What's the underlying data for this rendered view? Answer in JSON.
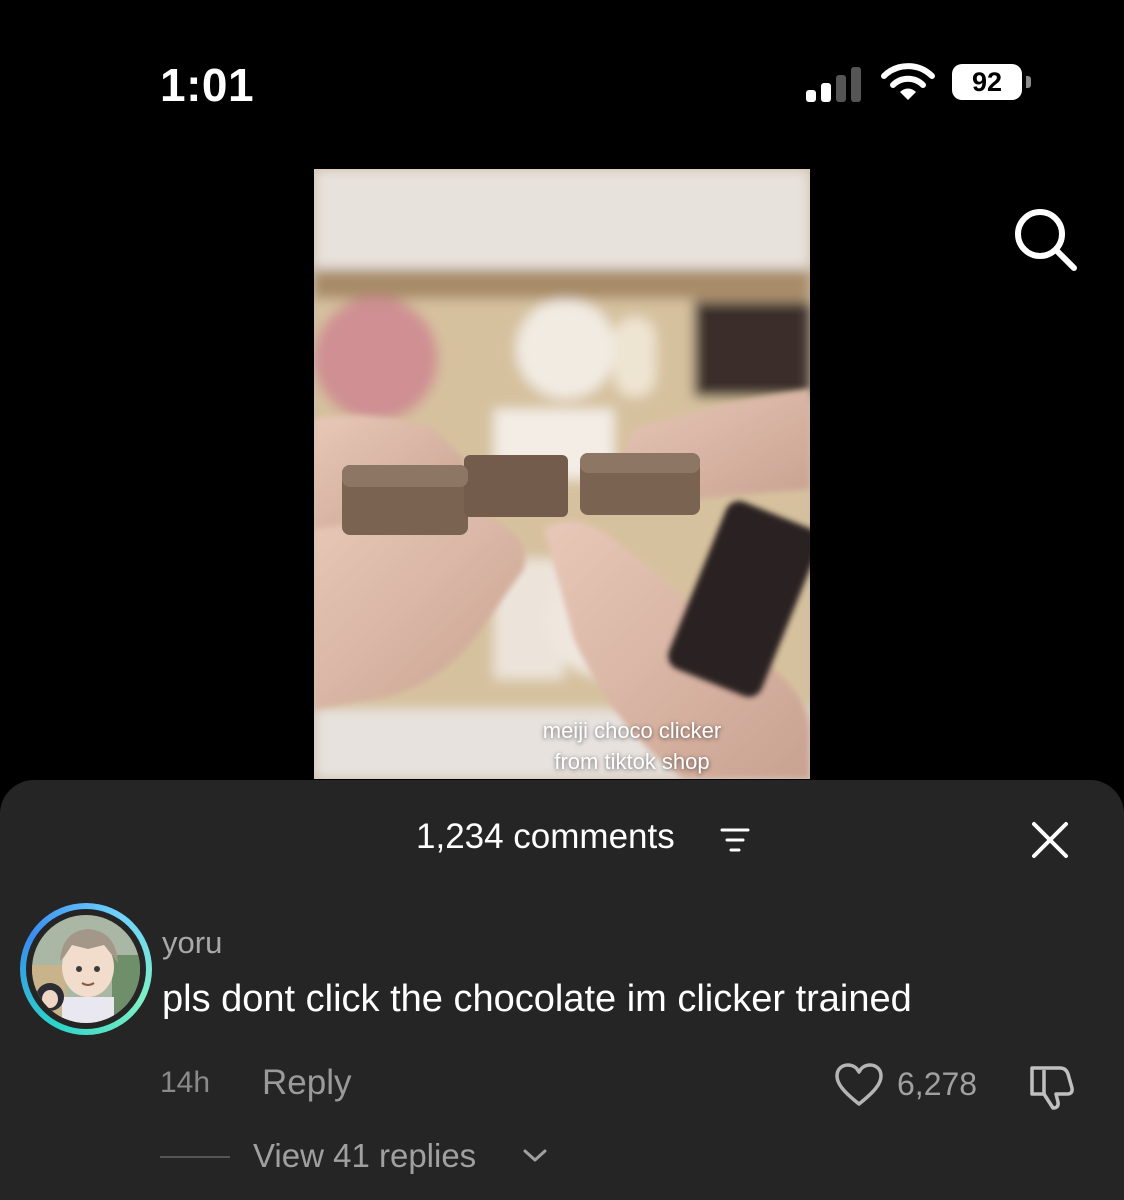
{
  "status_bar": {
    "time": "1:01",
    "battery": "92",
    "icons": [
      "signal-icon",
      "wifi-icon",
      "battery-icon"
    ]
  },
  "top_bar": {
    "search_icon": "search-icon"
  },
  "video": {
    "caption_line1": "meiji choco clicker",
    "caption_line2": "from tiktok shop"
  },
  "comments": {
    "count_label": "1,234 comments",
    "filter_icon": "filter-icon",
    "close_icon": "close-icon",
    "items": [
      {
        "username": "yoru",
        "text": "pls dont click the chocolate im clicker trained",
        "time_ago": "14h",
        "reply_label": "Reply",
        "likes": "6,278",
        "view_replies": "View 41 replies"
      }
    ]
  },
  "colors": {
    "background": "#000000",
    "sheet": "#252525",
    "secondary_text": "#a0a0a0",
    "avatar_ring": "#2ad4c8"
  }
}
